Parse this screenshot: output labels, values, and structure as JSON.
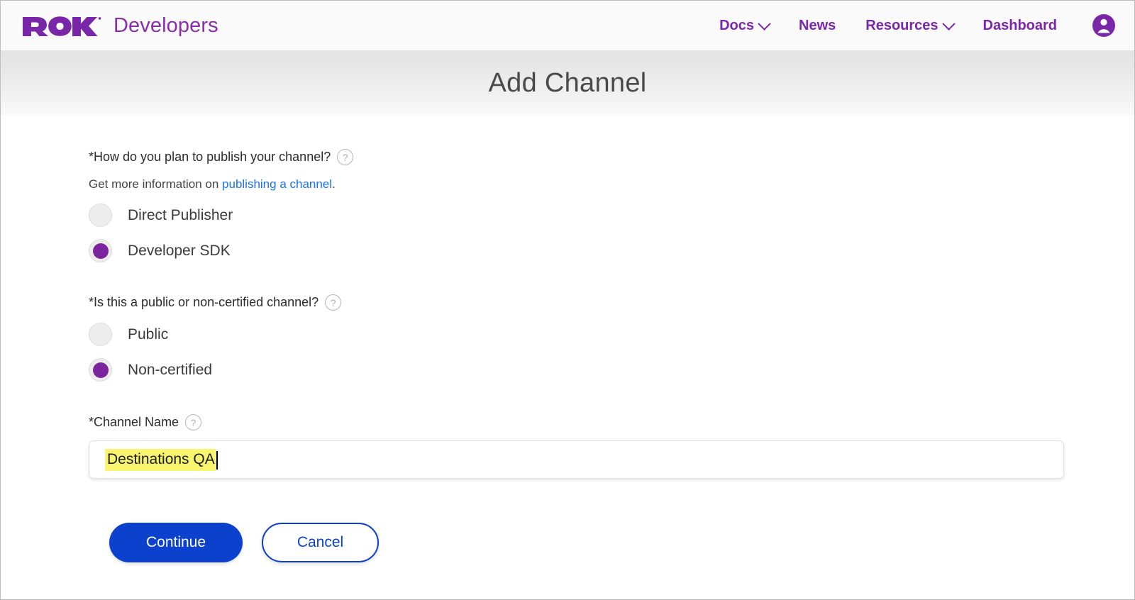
{
  "header": {
    "logo_alt": "Roku",
    "brand_word": "Developers",
    "nav": [
      {
        "label": "Docs",
        "has_dropdown": true
      },
      {
        "label": "News",
        "has_dropdown": false
      },
      {
        "label": "Resources",
        "has_dropdown": true
      },
      {
        "label": "Dashboard",
        "has_dropdown": false
      }
    ],
    "account_icon": "account-circle-icon",
    "brand_color": "#7a26a8"
  },
  "banner": {
    "title": "Add Channel"
  },
  "form": {
    "publish_question": {
      "label": "*How do you plan to publish your channel?",
      "help_icon": "?",
      "subtext_prefix": "Get more information on ",
      "subtext_link": "publishing a channel",
      "subtext_suffix": ".",
      "options": [
        {
          "label": "Direct Publisher",
          "selected": false
        },
        {
          "label": "Developer SDK",
          "selected": true
        }
      ]
    },
    "certification_question": {
      "label": "*Is this a public or non-certified channel?",
      "help_icon": "?",
      "options": [
        {
          "label": "Public",
          "selected": false
        },
        {
          "label": "Non-certified",
          "selected": true
        }
      ]
    },
    "channel_name": {
      "label": "*Channel Name",
      "help_icon": "?",
      "value": "Destinations QA",
      "highlight_color": "#faf56e"
    },
    "actions": {
      "continue_label": "Continue",
      "cancel_label": "Cancel",
      "primary_color": "#0b41cd"
    }
  }
}
